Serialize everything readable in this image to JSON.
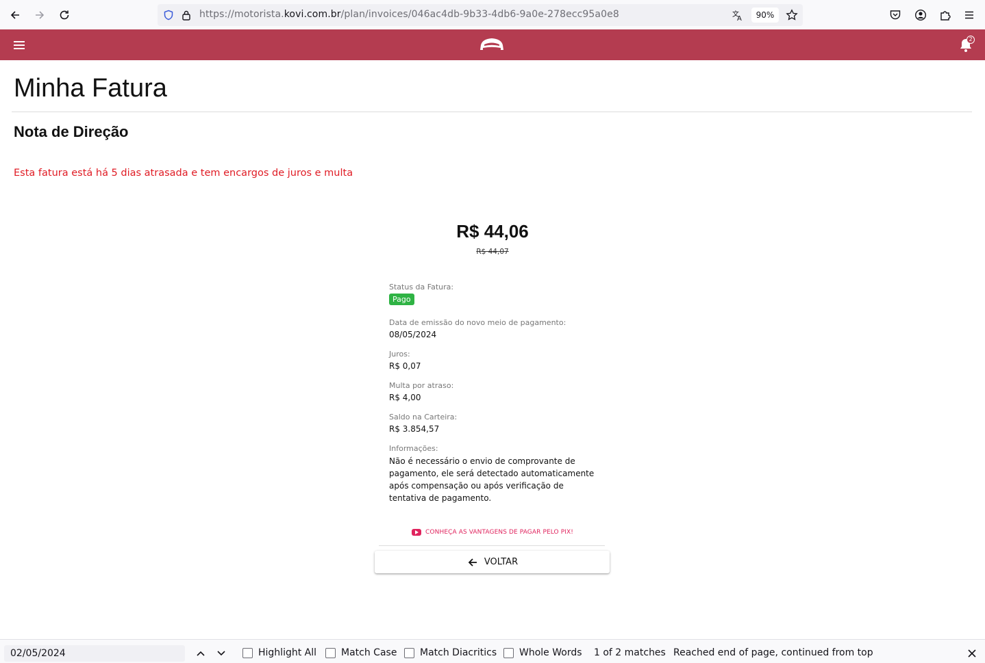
{
  "browser": {
    "url_prefix": "https://motorista.",
    "url_host": "kovi.com.br",
    "url_path": "/plan/invoices/046ac4db-9b33-4db6-9a0e-278ecc95a0e8",
    "zoom": "90%"
  },
  "app_header": {
    "notification_count": "2",
    "brand_color": "#b43c50"
  },
  "page": {
    "title": "Minha Fatura",
    "section_title": "Nota de Direção",
    "warning": "Esta fatura está há 5 dias atrasada e tem encargos de juros e multa",
    "amount": "R$ 44,06",
    "amount_original": "R$ 44,07"
  },
  "details": {
    "status_label": "Status da Fatura:",
    "status_value": "Pago",
    "issue_date_label": "Data de emissão do novo meio de pagamento:",
    "issue_date_value": "08/05/2024",
    "interest_label": "Juros:",
    "interest_value": "R$ 0,07",
    "fine_label": "Multa por atraso:",
    "fine_value": "R$ 4,00",
    "wallet_label": "Saldo na Carteira:",
    "wallet_value": "R$ 3.854,57",
    "info_label": "Informações:",
    "info_value": "Não é necessário o envio de comprovante de pagamento, ele será detectado automaticamente após compensação ou após verificação de tentativa de pagamento."
  },
  "actions": {
    "pix_link": "CONHEÇA AS VANTAGENS DE PAGAR PELO PIX!",
    "back_label": "VOLTAR"
  },
  "find_bar": {
    "query": "02/05/2024",
    "highlight_all": "Highlight All",
    "match_case": "Match Case",
    "match_diacritics": "Match Diacritics",
    "whole_words": "Whole Words",
    "match_count": "1 of 2 matches",
    "status": "Reached end of page, continued from top"
  }
}
